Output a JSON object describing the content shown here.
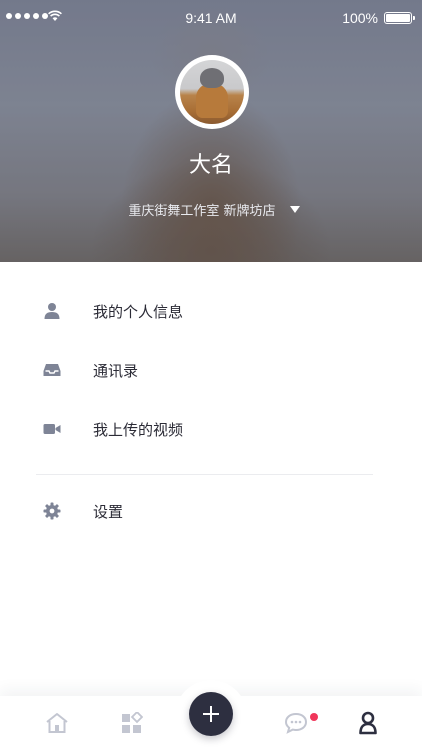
{
  "status_bar": {
    "time": "9:41 AM",
    "battery": "100%",
    "icons": [
      "signal-dots-icon",
      "wifi-icon",
      "battery-icon"
    ]
  },
  "profile": {
    "name": "大名",
    "organization": "重庆街舞工作室 新牌坊店",
    "dropdown_icon": "caret-down-icon"
  },
  "menu": {
    "items": [
      {
        "label": "我的个人信息",
        "icon": "person-icon"
      },
      {
        "label": "通讯录",
        "icon": "inbox-icon"
      },
      {
        "label": "我上传的视频",
        "icon": "video-camera-icon"
      }
    ],
    "settings": {
      "label": "设置",
      "icon": "gear-icon"
    }
  },
  "tabbar": {
    "tabs": [
      {
        "name": "home",
        "icon": "home-icon",
        "active": false
      },
      {
        "name": "categories",
        "icon": "grid-icon",
        "active": false
      },
      {
        "name": "add",
        "icon": "plus-icon",
        "active": false
      },
      {
        "name": "messages",
        "icon": "chat-bubble-icon",
        "active": false,
        "badge": true
      },
      {
        "name": "profile",
        "icon": "person-icon",
        "active": true
      }
    ]
  },
  "colors": {
    "accent_dark": "#2d2f40",
    "icon_gray": "#7e8496",
    "badge_red": "#f0365a",
    "text": "#2b2b36"
  }
}
